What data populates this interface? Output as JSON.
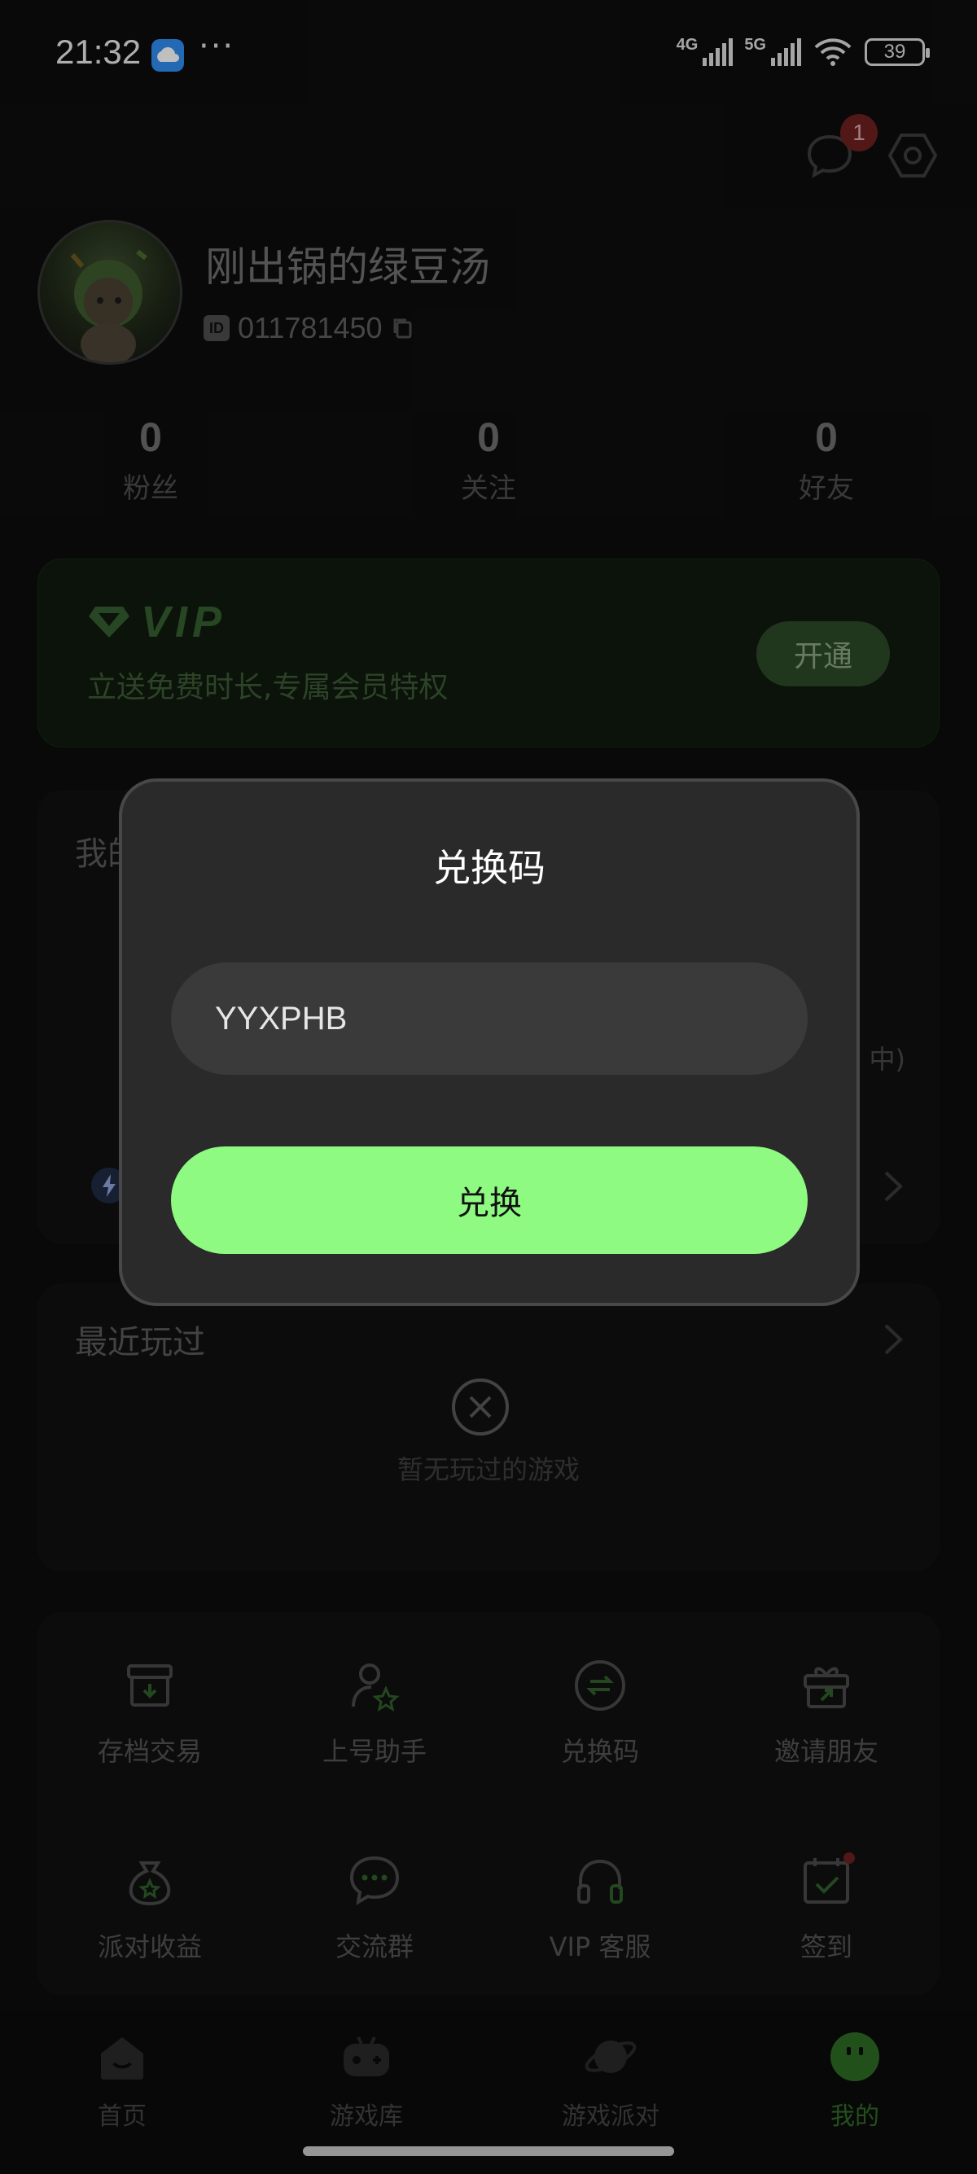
{
  "status_bar": {
    "time": "21:32",
    "more": "···",
    "net1": "4G",
    "net2": "5G",
    "battery": "39"
  },
  "header": {
    "message_badge": "1",
    "message_icon": "chat-bubble-icon",
    "settings_icon": "hexagon-settings-icon"
  },
  "profile": {
    "name": "刚出锅的绿豆汤",
    "id_tag": "ID",
    "id": "011781450"
  },
  "stats": [
    {
      "value": "0",
      "label": "粉丝"
    },
    {
      "value": "0",
      "label": "关注"
    },
    {
      "value": "0",
      "label": "好友"
    }
  ],
  "vip": {
    "title": "VIP",
    "subtitle": "立送免费时长,专属会员特权",
    "button": "开通"
  },
  "section_mine": {
    "title": "我的",
    "partial_text": "中)"
  },
  "recent": {
    "title": "最近玩过",
    "empty_text": "暂无玩过的游戏"
  },
  "tools": [
    {
      "label": "存档交易",
      "icon": "archive-box-icon"
    },
    {
      "label": "上号助手",
      "icon": "user-star-icon"
    },
    {
      "label": "兑换码",
      "icon": "exchange-icon"
    },
    {
      "label": "邀请朋友",
      "icon": "gift-icon"
    },
    {
      "label": "派对收益",
      "icon": "money-bag-icon"
    },
    {
      "label": "交流群",
      "icon": "chat-dots-icon"
    },
    {
      "label": "VIP 客服",
      "icon": "headset-icon"
    },
    {
      "label": "签到",
      "icon": "calendar-check-icon"
    }
  ],
  "tabs": [
    {
      "label": "首页",
      "icon": "home-icon"
    },
    {
      "label": "游戏库",
      "icon": "gamepad-icon"
    },
    {
      "label": "游戏派对",
      "icon": "planet-icon"
    },
    {
      "label": "我的",
      "icon": "smiley-face-icon"
    }
  ],
  "dialog": {
    "title": "兑换码",
    "input_value": "YYXPHB",
    "button": "兑换"
  },
  "colors": {
    "accent": "#8efa82",
    "background": "#0d0d0d",
    "dialog": "#2a2a2a"
  }
}
